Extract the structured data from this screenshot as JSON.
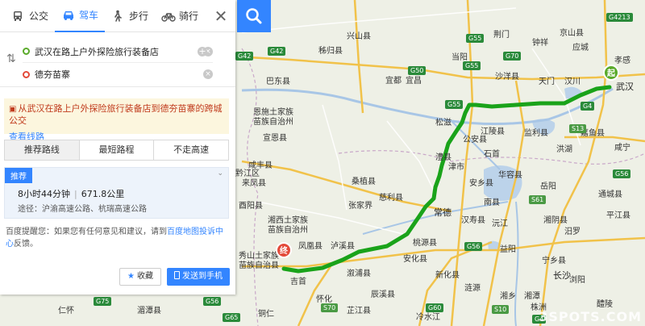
{
  "modes": [
    {
      "label": "公交",
      "icon": "bus-icon",
      "active": false
    },
    {
      "label": "驾车",
      "icon": "car-icon",
      "active": true
    },
    {
      "label": "步行",
      "icon": "walk-icon",
      "active": false
    },
    {
      "label": "骑行",
      "icon": "bike-icon",
      "active": false
    }
  ],
  "route": {
    "start": "武汉在路上户外探险旅行装备店",
    "end": "德夯苗寨"
  },
  "notice": {
    "text": "从武汉在路上户外探险旅行装备店到德夯苗寨的跨城公交",
    "link": "查看线路"
  },
  "tabs": [
    "推荐路线",
    "最短路程",
    "不走高速"
  ],
  "plan": {
    "badge": "推荐",
    "duration": "8小时44分钟",
    "distance": "671.8公里",
    "via": "途径：沪渝高速公路、杭瑞高速公路"
  },
  "tip": {
    "prefix": "百度提醒您：如果您有任何意见和建议，请到",
    "link": "百度地图投诉中心",
    "suffix": "反馈。"
  },
  "buttons": {
    "favorite": "收藏",
    "send": "发送到手机"
  },
  "map": {
    "places": [
      {
        "t": "宜都",
        "big": false
      },
      {
        "t": "宜昌",
        "big": false
      },
      {
        "t": "钟祥",
        "big": false
      },
      {
        "t": "京山县",
        "big": false
      },
      {
        "t": "应城",
        "big": false
      },
      {
        "t": "孝感",
        "big": false
      },
      {
        "t": "汉川",
        "big": false
      },
      {
        "t": "武汉",
        "big": true
      },
      {
        "t": "天门",
        "big": false
      },
      {
        "t": "沙洋县",
        "big": false
      },
      {
        "t": "荆门",
        "big": false
      },
      {
        "t": "当阳",
        "big": false
      },
      {
        "t": "巴东县",
        "big": false
      },
      {
        "t": "秭归县",
        "big": false
      },
      {
        "t": "兴山县",
        "big": false
      },
      {
        "t": "恩施土家族",
        "big": false
      },
      {
        "t": "苗族自治州",
        "big": false
      },
      {
        "t": "宣恩县",
        "big": false
      },
      {
        "t": "咸丰县",
        "big": false
      },
      {
        "t": "来凤县",
        "big": false
      },
      {
        "t": "松滋",
        "big": false
      },
      {
        "t": "公安县",
        "big": false
      },
      {
        "t": "江陵县",
        "big": false
      },
      {
        "t": "监利县",
        "big": false
      },
      {
        "t": "石首",
        "big": false
      },
      {
        "t": "洪湖",
        "big": false
      },
      {
        "t": "嘉鱼县",
        "big": false
      },
      {
        "t": "咸宁",
        "big": false
      },
      {
        "t": "通城县",
        "big": false
      },
      {
        "t": "岳阳",
        "big": false
      },
      {
        "t": "华容县",
        "big": false
      },
      {
        "t": "安乡县",
        "big": false
      },
      {
        "t": "南县",
        "big": false
      },
      {
        "t": "津市",
        "big": false
      },
      {
        "t": "澧县",
        "big": false
      },
      {
        "t": "常德",
        "big": false
      },
      {
        "t": "汉寿县",
        "big": false
      },
      {
        "t": "沅江",
        "big": false
      },
      {
        "t": "湘阴县",
        "big": false
      },
      {
        "t": "汨罗",
        "big": false
      },
      {
        "t": "平江县",
        "big": false
      },
      {
        "t": "益阳",
        "big": false
      },
      {
        "t": "宁乡县",
        "big": false
      },
      {
        "t": "浏阳",
        "big": false
      },
      {
        "t": "桃源县",
        "big": false
      },
      {
        "t": "张家界",
        "big": false
      },
      {
        "t": "桑植县",
        "big": false
      },
      {
        "t": "慈利县",
        "big": false
      },
      {
        "t": "湘西土家族",
        "big": false
      },
      {
        "t": "苗族自治州",
        "big": false
      },
      {
        "t": "怀化",
        "big": false
      },
      {
        "t": "溆浦县",
        "big": false
      },
      {
        "t": "安化县",
        "big": false
      },
      {
        "t": "新化县",
        "big": false
      },
      {
        "t": "涟源",
        "big": false
      },
      {
        "t": "冷水江",
        "big": false
      },
      {
        "t": "湘乡",
        "big": false
      },
      {
        "t": "湘潭",
        "big": false
      },
      {
        "t": "株洲",
        "big": false
      },
      {
        "t": "醴陵",
        "big": false
      },
      {
        "t": "长沙",
        "big": false
      },
      {
        "t": "吉首",
        "big": false
      },
      {
        "t": "铜仁",
        "big": false
      },
      {
        "t": "秀山土家族",
        "big": false
      },
      {
        "t": "苗族自治县",
        "big": false
      },
      {
        "t": "仁怀",
        "big": false
      },
      {
        "t": "湄潭县",
        "big": false
      },
      {
        "t": "酉阳县",
        "big": false
      },
      {
        "t": "黔江区",
        "big": false
      },
      {
        "t": "泸溪县",
        "big": false
      },
      {
        "t": "凤凰县",
        "big": false
      },
      {
        "t": "辰溪县",
        "big": false
      },
      {
        "t": "芷江县",
        "big": false
      }
    ],
    "shields": [
      {
        "t": "G4213",
        "k": "g"
      },
      {
        "t": "G42",
        "k": "g"
      },
      {
        "t": "G42",
        "k": "g"
      },
      {
        "t": "G55",
        "k": "g"
      },
      {
        "t": "G70",
        "k": "g"
      },
      {
        "t": "G50",
        "k": "g"
      },
      {
        "t": "G55",
        "k": "g"
      },
      {
        "t": "G55",
        "k": "g"
      },
      {
        "t": "G4",
        "k": "g"
      },
      {
        "t": "S13",
        "k": "s"
      },
      {
        "t": "G56",
        "k": "g"
      },
      {
        "t": "S61",
        "k": "s"
      },
      {
        "t": "G56",
        "k": "g"
      },
      {
        "t": "G75",
        "k": "g"
      },
      {
        "t": "G56",
        "k": "g"
      },
      {
        "t": "S70",
        "k": "s"
      },
      {
        "t": "G60",
        "k": "g"
      },
      {
        "t": "G4",
        "k": "g"
      },
      {
        "t": "G65",
        "k": "g"
      },
      {
        "t": "S10",
        "k": "s"
      }
    ],
    "start_marker": "起",
    "end_marker": "终",
    "watermark": "3SPOTS.COM"
  }
}
